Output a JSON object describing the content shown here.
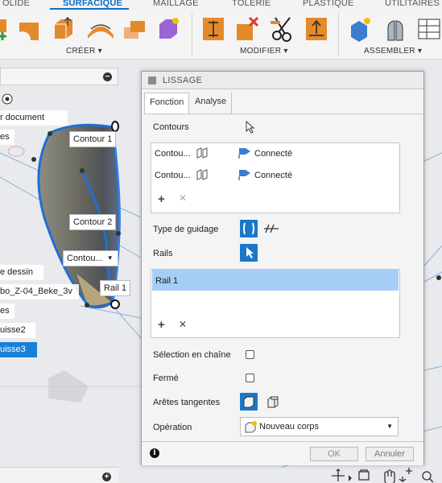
{
  "top_tabs": [
    "OLIDE",
    "SURFACIQUE",
    "MAILLAGE",
    "TÔLERIE",
    "PLASTIQUE",
    "UTILITAIRES"
  ],
  "ribbon_groups": {
    "create": "CRÉER ▾",
    "modify": "MODIFIER ▾",
    "assemble": "ASSEMBLER ▾"
  },
  "browser": {
    "items": [
      "r document",
      "es",
      "e dessin",
      "bo_Z-04_Beke_3v",
      "es",
      "uisse2",
      "uisse3"
    ],
    "minus_symbol": "−",
    "plus_symbol": "+"
  },
  "viewport_labels": {
    "contour1": "Contour 1",
    "contour2": "Contour 2",
    "contour_dropdown": "Contou...",
    "rail1": "Rail 1"
  },
  "dialog": {
    "title": "LISSAGE",
    "tabs": {
      "function": "Fonction",
      "analysis": "Analyse"
    },
    "contours_label": "Contours",
    "contour_rows": [
      {
        "name": "Contou...",
        "state": "Connecté"
      },
      {
        "name": "Contou...",
        "state": "Connecté"
      }
    ],
    "guidance_type_label": "Type de guidage",
    "rails_label": "Rails",
    "rail_rows": [
      "Rail 1"
    ],
    "chain_selection_label": "Sélection en chaîne",
    "closed_label": "Fermé",
    "tangent_edges_label": "Arêtes tangentes",
    "operation_label": "Opération",
    "operation_value": "Nouveau corps",
    "add_symbol": "+",
    "remove_symbol": "✕",
    "ok_label": "OK",
    "cancel_label": "Annuler",
    "info_symbol": "i"
  },
  "colors": {
    "accent": "#0b6fc1",
    "selected_row": "#a6cdf5",
    "active_icon": "#1978c9"
  }
}
